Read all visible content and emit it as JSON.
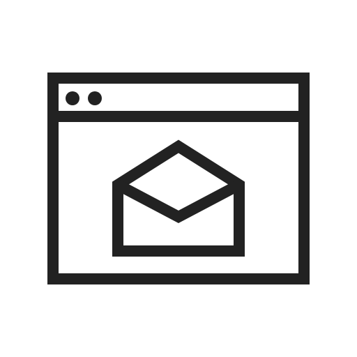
{
  "icon": {
    "name": "browser-window-open-envelope-icon",
    "color": "#222222",
    "background": "#ffffff",
    "parts": {
      "window": "browser-window-icon",
      "title_bar_dots": [
        "window-dot-icon",
        "window-dot-icon"
      ],
      "envelope": "open-envelope-icon"
    }
  }
}
